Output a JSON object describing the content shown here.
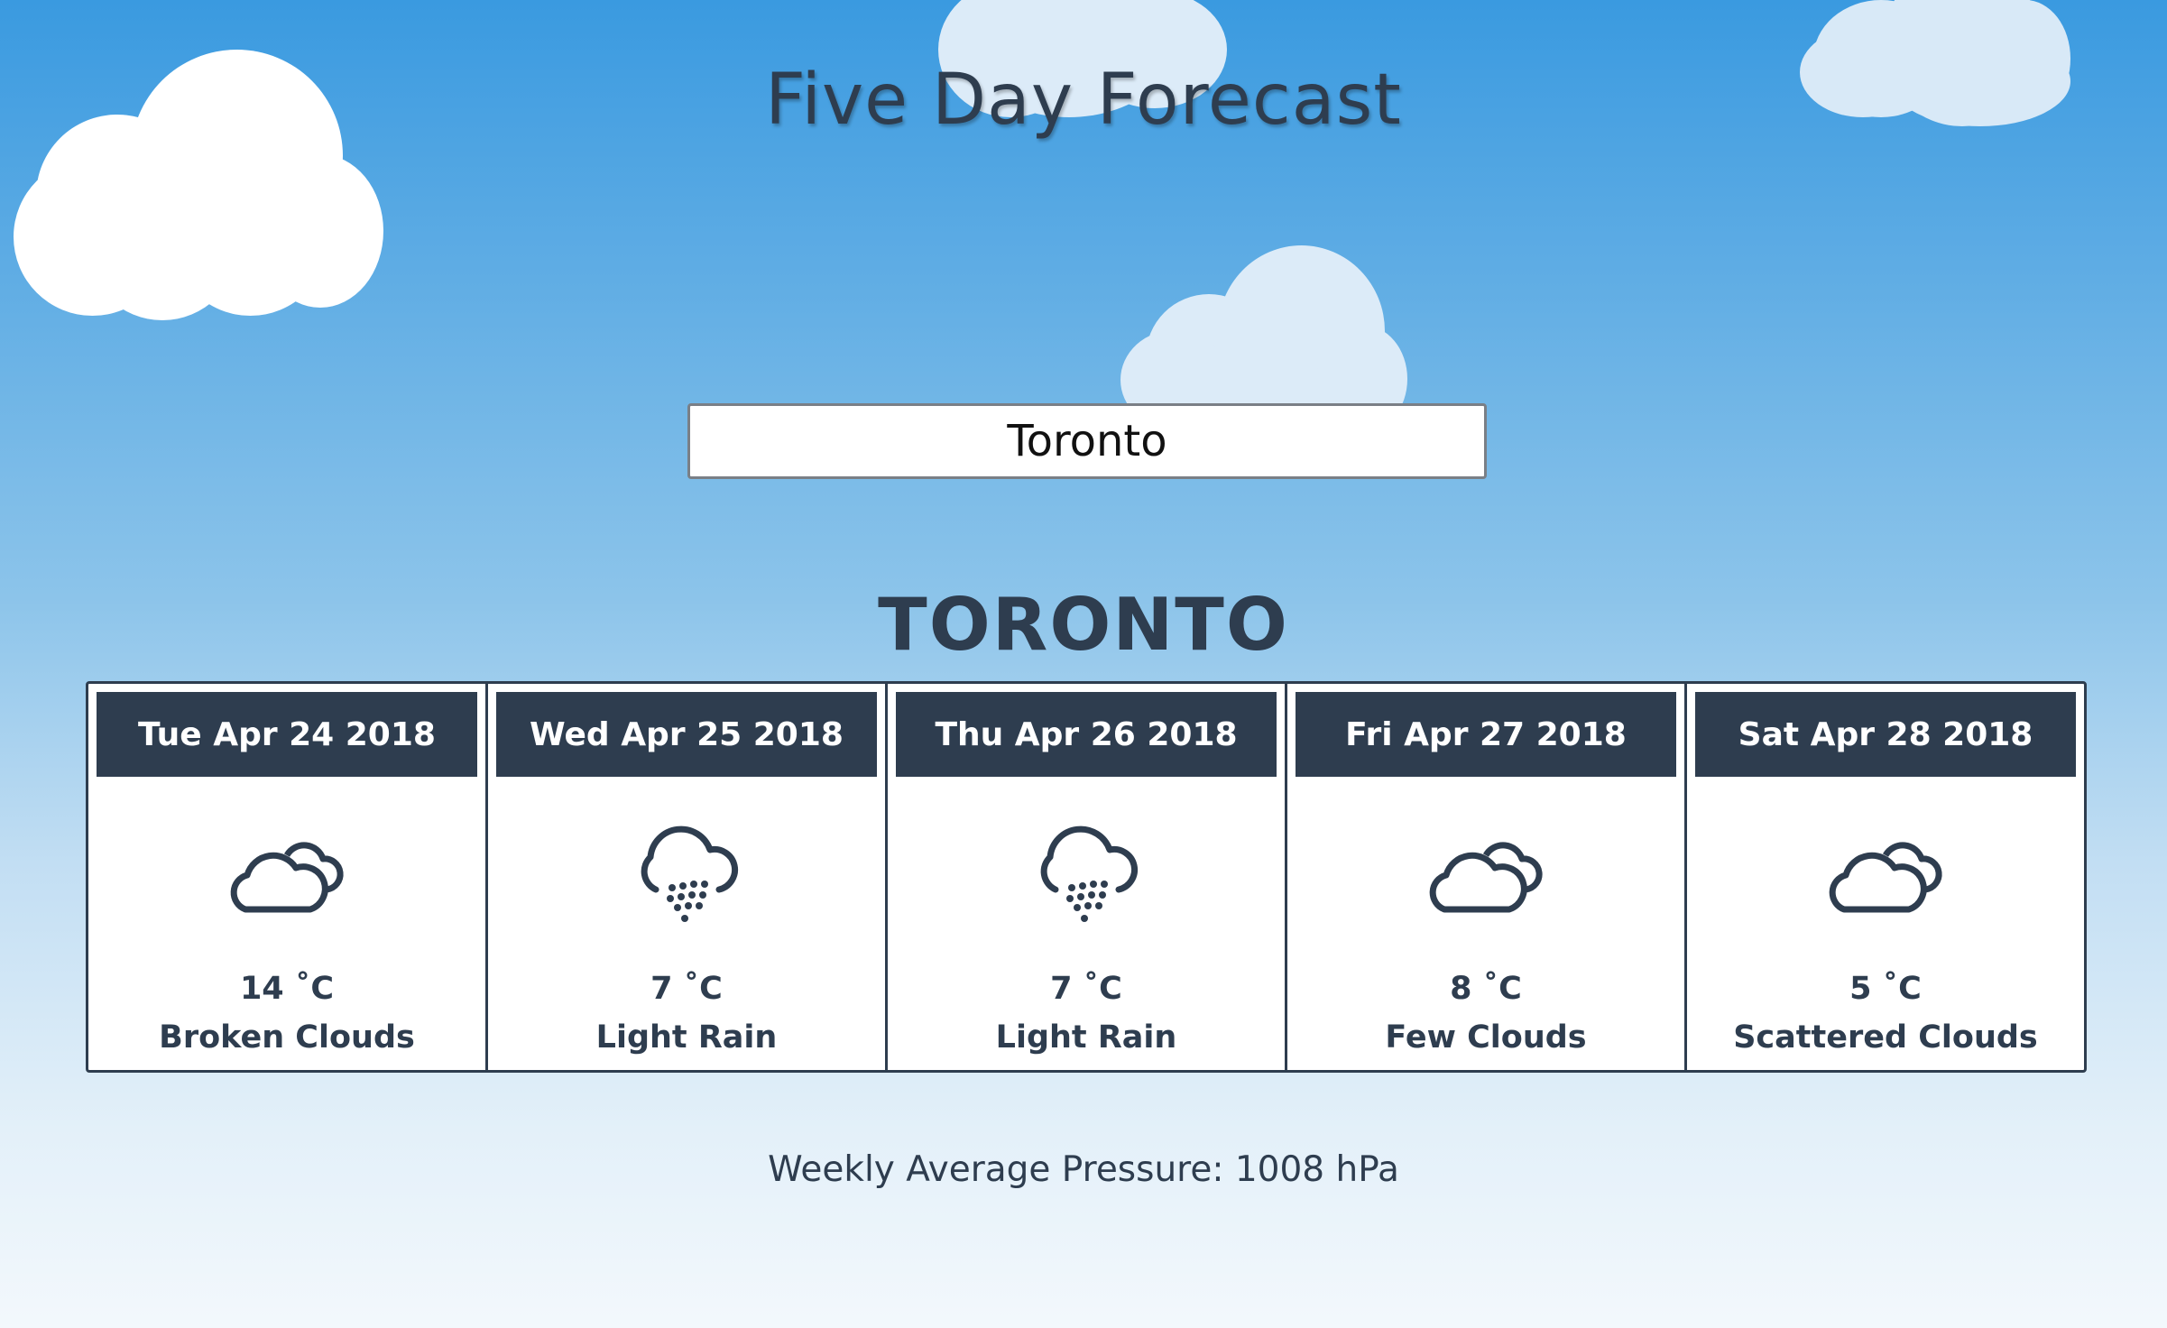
{
  "header": {
    "title": "Five Day Forecast"
  },
  "search": {
    "value": "Toronto"
  },
  "city": {
    "name": "TORONTO"
  },
  "forecast": [
    {
      "date": "Tue Apr 24 2018",
      "icon": "clouds-icon",
      "temp": "14 ˚C",
      "description": "Broken Clouds"
    },
    {
      "date": "Wed Apr 25 2018",
      "icon": "rain-icon",
      "temp": "7 ˚C",
      "description": "Light Rain"
    },
    {
      "date": "Thu Apr 26 2018",
      "icon": "rain-icon",
      "temp": "7 ˚C",
      "description": "Light Rain"
    },
    {
      "date": "Fri Apr 27 2018",
      "icon": "clouds-icon",
      "temp": "8 ˚C",
      "description": "Few Clouds"
    },
    {
      "date": "Sat Apr 28 2018",
      "icon": "clouds-icon",
      "temp": "5 ˚C",
      "description": "Scattered Clouds"
    }
  ],
  "footer": {
    "pressure": "Weekly Average Pressure: 1008 hPa"
  },
  "colors": {
    "primary_dark": "#2e3d4f",
    "sky_top": "#3a9ae0",
    "sky_bottom": "#f3f8fc",
    "card_bg": "#ffffff"
  }
}
